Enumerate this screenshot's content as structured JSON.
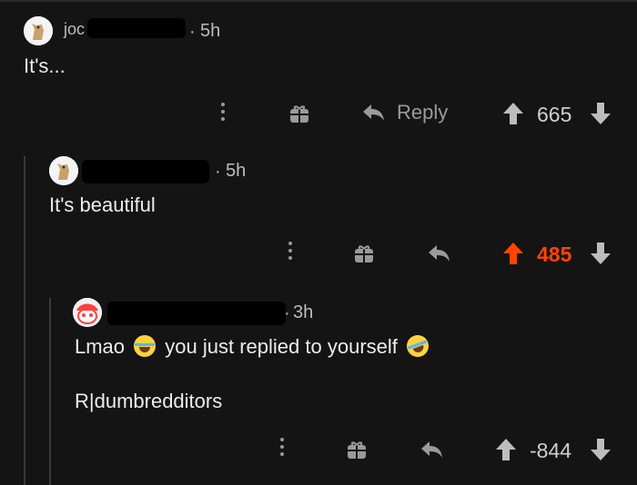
{
  "comments": [
    {
      "username_partial": "joc",
      "age": "5h",
      "text": "It's...",
      "actions": {
        "more": "more-options",
        "award": "award-icon",
        "reply_label": "Reply"
      },
      "score": "665"
    },
    {
      "username_partial": "",
      "age": "5h",
      "text": "It's beautiful",
      "actions": {
        "more": "more-options",
        "award": "award-icon",
        "reply_label": ""
      },
      "score": "485"
    },
    {
      "username_partial": "",
      "age": "3h",
      "text_part1": "Lmao",
      "text_part2": "you just replied to yourself",
      "text_line2": "R|dumbredditors",
      "actions": {
        "more": "more-options",
        "award": "award-icon",
        "reply_label": ""
      },
      "score": "-844"
    }
  ],
  "colors": {
    "background": "#141414",
    "upvoted": "#ff4500",
    "muted": "#9a9a9a"
  }
}
